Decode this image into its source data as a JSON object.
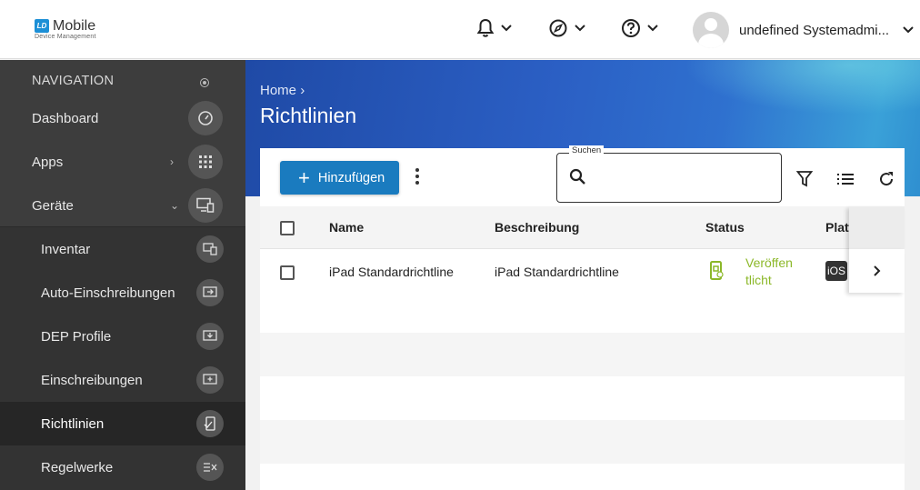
{
  "brand": {
    "badge": "LD",
    "name": "Mobile",
    "subtitle": "Device Management"
  },
  "topbar": {
    "user_name": "undefined Systemadmi..."
  },
  "sidebar": {
    "heading": "NAVIGATION",
    "items": [
      {
        "label": "Dashboard",
        "icon": "gauge-icon"
      },
      {
        "label": "Apps",
        "icon": "grid-icon"
      },
      {
        "label": "Geräte",
        "icon": "devices-icon"
      }
    ],
    "sub_items": [
      {
        "label": "Inventar",
        "icon": "inventory-icon"
      },
      {
        "label": "Auto-Einschreibungen",
        "icon": "auto-enroll-icon"
      },
      {
        "label": "DEP Profile",
        "icon": "dep-profile-icon"
      },
      {
        "label": "Einschreibungen",
        "icon": "enroll-icon"
      },
      {
        "label": "Richtlinien",
        "icon": "policy-icon",
        "active": true
      },
      {
        "label": "Regelwerke",
        "icon": "rules-icon"
      }
    ]
  },
  "header": {
    "breadcrumb": "Home",
    "title": "Richtlinien"
  },
  "toolbar": {
    "add_label": "Hinzufügen",
    "search_label": "Suchen",
    "search_value": ""
  },
  "table": {
    "columns": [
      "Name",
      "Beschreibung",
      "Status",
      "Platt"
    ],
    "rows": [
      {
        "name": "iPad Standardrichtline",
        "description": "iPad Standardrichtline",
        "status_line1": "Veröffen",
        "status_line2": "tlicht",
        "platform": "iOS"
      }
    ]
  },
  "colors": {
    "accent": "#1a7bbf",
    "sidebar": "#3d3d3d",
    "status_published": "#8cb829"
  }
}
